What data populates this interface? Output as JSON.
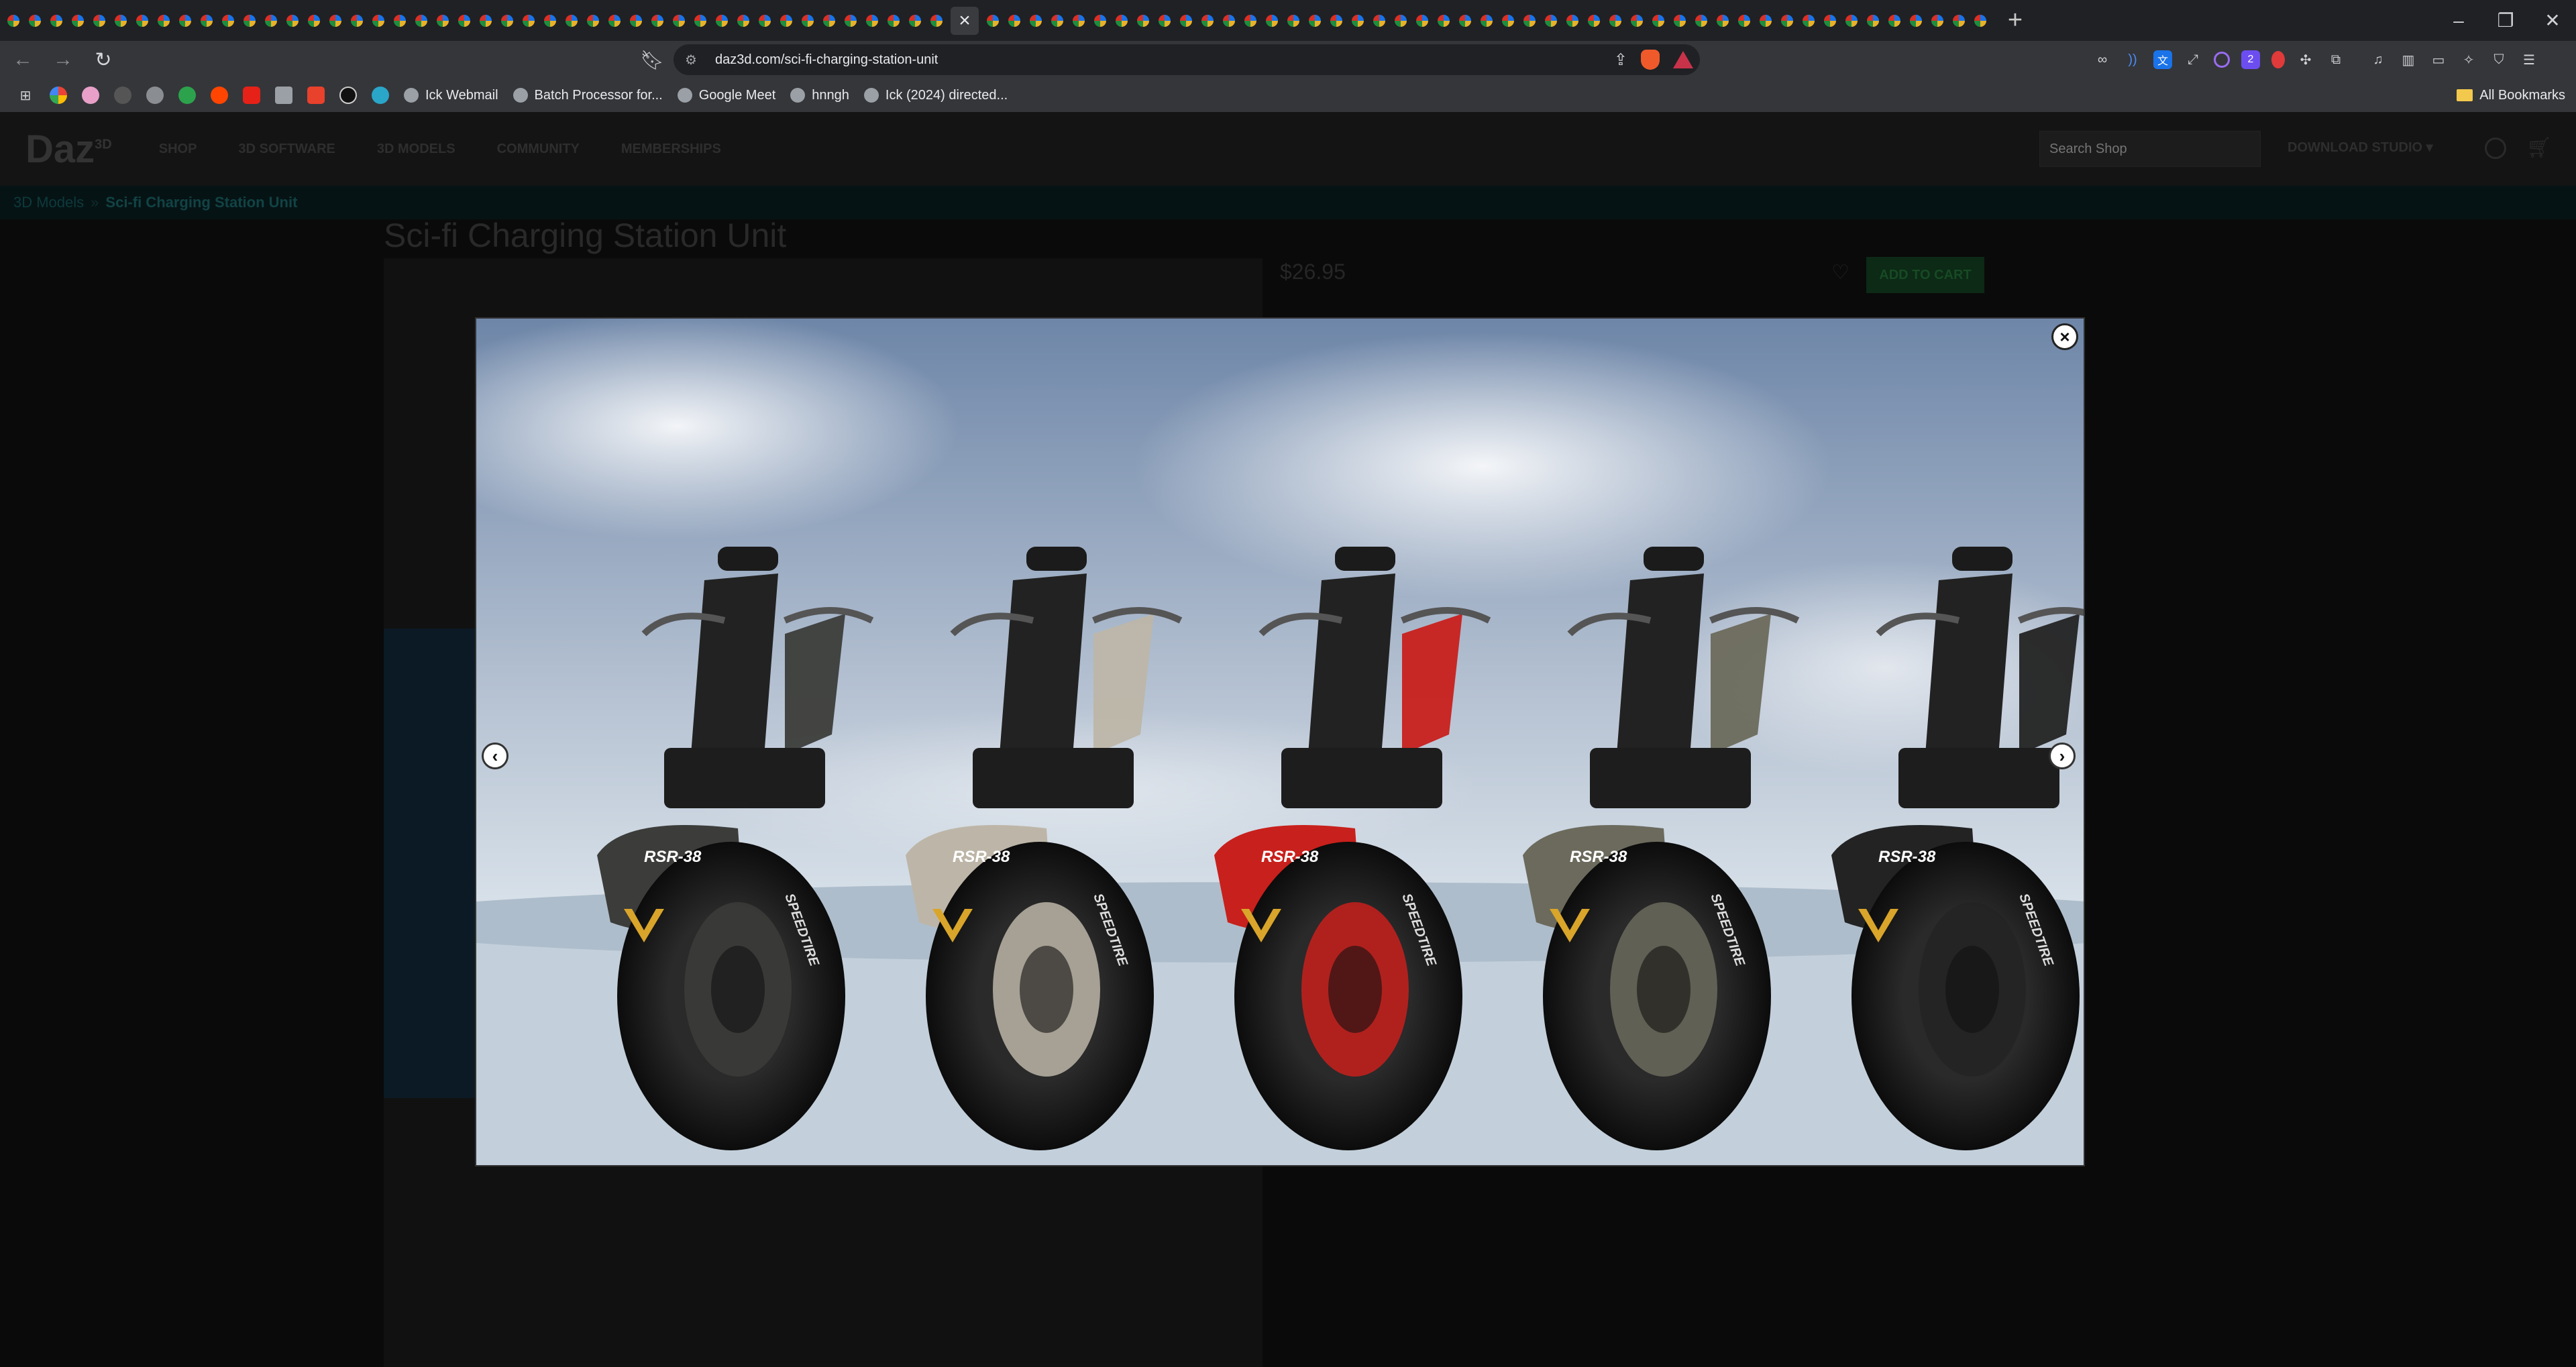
{
  "browser": {
    "active_tab_close": "×",
    "new_tab": "+",
    "url": "daz3d.com/sci-fi-charging-station-unit",
    "window_controls": {
      "minimize": "–",
      "restore": "❐",
      "close": "✕"
    },
    "bookmarks": [
      {
        "label": "Ick Webmail"
      },
      {
        "label": "Batch Processor for..."
      },
      {
        "label": "Google Meet"
      },
      {
        "label": "hnngh"
      },
      {
        "label": "Ick (2024) directed..."
      }
    ],
    "all_bookmarks": "All Bookmarks"
  },
  "site": {
    "logo": "Daz",
    "logo_sup": "3D",
    "nav": [
      "SHOP",
      "3D SOFTWARE",
      "3D MODELS",
      "COMMUNITY",
      "MEMBERSHIPS"
    ],
    "search_placeholder": "Search Shop",
    "download_studio": "DOWNLOAD STUDIO ▾",
    "breadcrumb": {
      "parent": "3D Models",
      "separator": "»",
      "current": "Sci-fi Charging Station Unit"
    },
    "product_title": "Sci-fi Charging Station Unit",
    "price": "$26.95",
    "add_to_cart": "ADD TO CART"
  },
  "lightbox": {
    "close": "×",
    "prev": "‹",
    "next": "›",
    "vehicle_badge": "RSR-38",
    "tire_text": "SPEEDTIRE",
    "vehicle_colors": [
      "#3c3d3a",
      "#bdb6a8",
      "#c8201c",
      "#6b6a5c",
      "#232323"
    ]
  }
}
